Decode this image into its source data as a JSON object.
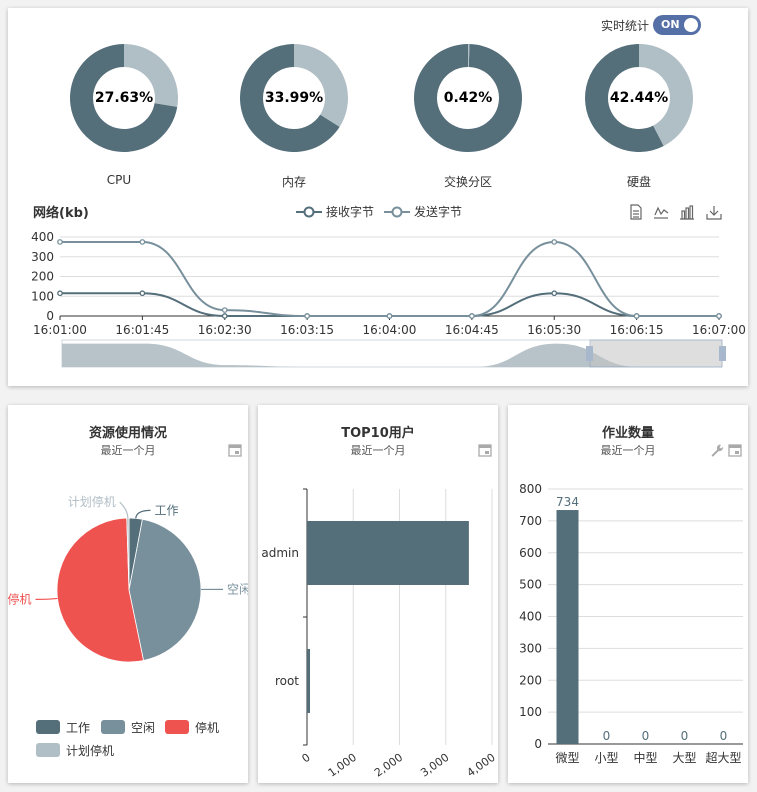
{
  "realtime": {
    "label": "实时统计",
    "state": "ON"
  },
  "gauges": [
    {
      "name": "CPU",
      "value": 27.63,
      "label": "27.63%"
    },
    {
      "name": "内存",
      "value": 33.99,
      "label": "33.99%"
    },
    {
      "name": "交换分区",
      "value": 0.42,
      "label": "0.42%"
    },
    {
      "name": "硬盘",
      "value": 42.44,
      "label": "42.44%"
    }
  ],
  "colors": {
    "primary": "#546e7a",
    "light": "#b0bec5",
    "mid": "#78909c",
    "red": "#ef5350",
    "grey": "#9ea7ad"
  },
  "network": {
    "title": "网络(kb)",
    "legend": [
      "接收字节",
      "发送字节"
    ],
    "toolbox": [
      "data-view-icon",
      "line-icon",
      "bar-icon",
      "download-icon"
    ]
  },
  "chart_data": [
    {
      "type": "line",
      "title": "网络(kb)",
      "x": [
        "16:01:00",
        "16:01:45",
        "16:02:30",
        "16:03:15",
        "16:04:00",
        "16:04:45",
        "16:05:30",
        "16:06:15",
        "16:07:00"
      ],
      "yticks": [
        "0",
        "100",
        "200",
        "300",
        "400"
      ],
      "ylim": [
        0,
        400
      ],
      "series": [
        {
          "name": "接收字节",
          "points": [
            [
              0,
              115
            ],
            [
              45,
              115
            ],
            [
              90,
              0
            ],
            [
              135,
              0
            ],
            [
              180,
              0
            ],
            [
              225,
              0
            ],
            [
              270,
              115
            ],
            [
              315,
              0
            ],
            [
              360,
              0
            ]
          ]
        },
        {
          "name": "发送字节",
          "points": [
            [
              0,
              375
            ],
            [
              45,
              375
            ],
            [
              90,
              30
            ],
            [
              135,
              0
            ],
            [
              180,
              0
            ],
            [
              225,
              0
            ],
            [
              270,
              375
            ],
            [
              315,
              0
            ],
            [
              360,
              0
            ]
          ]
        }
      ],
      "grid": true,
      "legend": "top-center"
    },
    {
      "type": "pie",
      "title": "资源使用情况",
      "subtitle": "最近一个月",
      "slices": [
        {
          "name": "工作",
          "value": 3
        },
        {
          "name": "空闲",
          "value": 44
        },
        {
          "name": "停机",
          "value": 53
        },
        {
          "name": "计划停机",
          "value": 0.5
        }
      ],
      "legend": "bottom"
    },
    {
      "type": "bar",
      "title": "TOP10用户",
      "subtitle": "最近一个月",
      "orientation": "horizontal",
      "categories": [
        "admin",
        "root"
      ],
      "values": [
        3500,
        50
      ],
      "xticks": [
        "0",
        "1,000",
        "2,000",
        "3,000",
        "4,000"
      ],
      "xlim": [
        0,
        4000
      ]
    },
    {
      "type": "bar",
      "title": "作业数量",
      "subtitle": "最近一个月",
      "categories": [
        "微型",
        "小型",
        "中型",
        "大型",
        "超大型"
      ],
      "values": [
        734,
        0,
        0,
        0,
        0
      ],
      "yticks": [
        "0",
        "100",
        "200",
        "300",
        "400",
        "500",
        "600",
        "700",
        "800"
      ],
      "ylim": [
        0,
        800
      ]
    }
  ]
}
